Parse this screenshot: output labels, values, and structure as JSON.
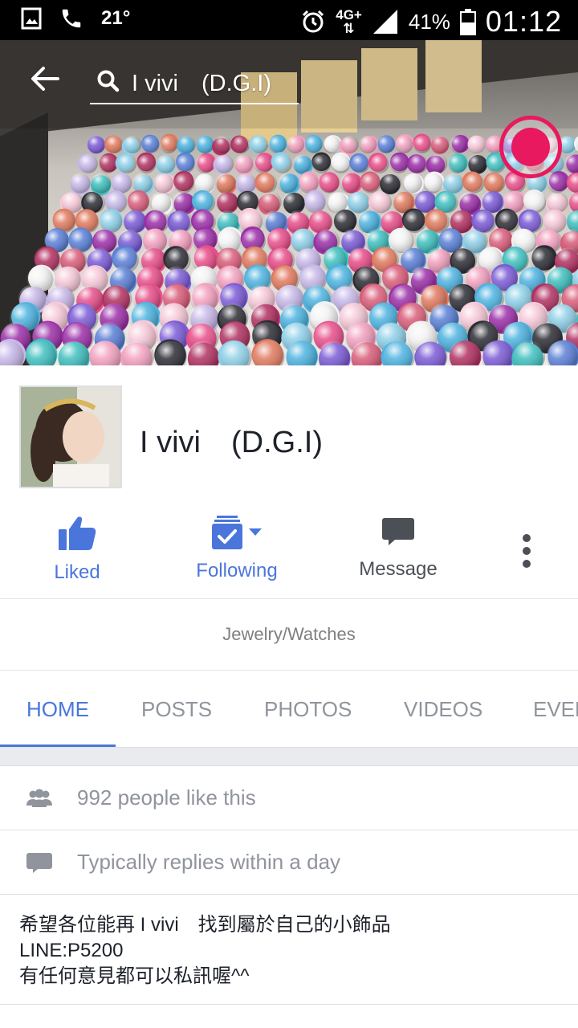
{
  "status_bar": {
    "temperature": "21°",
    "network_top": "4G+",
    "network_bottom": "⇅",
    "battery_percent": "41%",
    "time": "01:12"
  },
  "header": {
    "search_text": "I vivi　(D.G.I)"
  },
  "profile": {
    "page_name": "I vivi　(D.G.I)"
  },
  "actions": {
    "liked_label": "Liked",
    "following_label": "Following",
    "message_label": "Message"
  },
  "category": "Jewelry/Watches",
  "tabs": [
    {
      "label": "HOME"
    },
    {
      "label": "POSTS"
    },
    {
      "label": "PHOTOS"
    },
    {
      "label": "VIDEOS"
    },
    {
      "label": "EVENTS"
    }
  ],
  "info": {
    "likes_text": "992 people like this",
    "reply_text": "Typically replies within a day",
    "about_lines": [
      "希望各位能再 I vivi　找到屬於自己的小飾品",
      "LINE:P5200",
      "有任何意見都可以私訊喔^^"
    ]
  },
  "colors": {
    "accent": "#4a76dc",
    "record": "#e8195e",
    "muted": "#90949c"
  }
}
